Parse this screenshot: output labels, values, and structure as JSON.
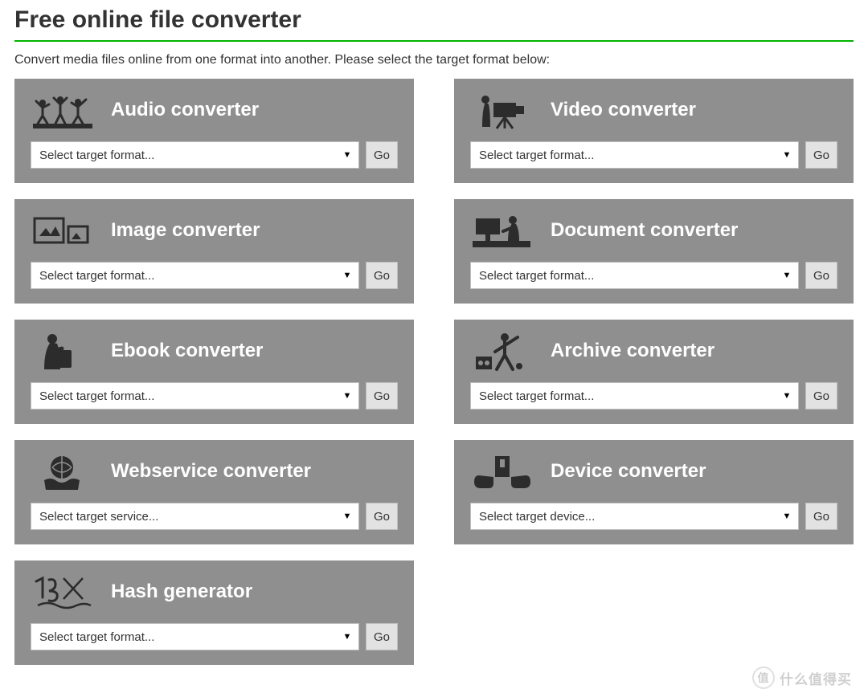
{
  "page": {
    "title": "Free online file converter",
    "intro": "Convert media files online from one format into another. Please select the target format below:"
  },
  "common": {
    "go_label": "Go"
  },
  "cards": [
    {
      "id": "audio",
      "title": "Audio converter",
      "select_text": "Select target format...",
      "icon": "audio"
    },
    {
      "id": "video",
      "title": "Video converter",
      "select_text": "Select target format...",
      "icon": "video"
    },
    {
      "id": "image",
      "title": "Image converter",
      "select_text": "Select target format...",
      "icon": "image"
    },
    {
      "id": "document",
      "title": "Document converter",
      "select_text": "Select target format...",
      "icon": "document"
    },
    {
      "id": "ebook",
      "title": "Ebook converter",
      "select_text": "Select target format...",
      "icon": "ebook"
    },
    {
      "id": "archive",
      "title": "Archive converter",
      "select_text": "Select target format...",
      "icon": "archive"
    },
    {
      "id": "webservice",
      "title": "Webservice converter",
      "select_text": "Select target service...",
      "icon": "webservice"
    },
    {
      "id": "device",
      "title": "Device converter",
      "select_text": "Select target device...",
      "icon": "device"
    },
    {
      "id": "hash",
      "title": "Hash generator",
      "select_text": "Select target format...",
      "icon": "hash"
    }
  ],
  "watermark": {
    "badge": "值",
    "text": "什么值得买"
  }
}
